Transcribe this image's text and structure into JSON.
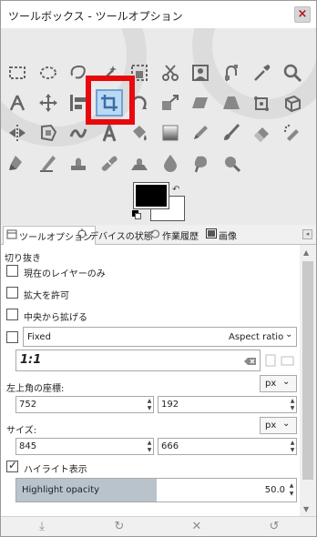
{
  "window": {
    "title": "ツールボックス - ツールオプション",
    "close_glyph": "×"
  },
  "tools": [
    {
      "name": "rect-select-icon"
    },
    {
      "name": "ellipse-select-icon"
    },
    {
      "name": "free-select-icon"
    },
    {
      "name": "fuzzy-select-icon"
    },
    {
      "name": "by-color-select-icon"
    },
    {
      "name": "scissors-select-icon"
    },
    {
      "name": "foreground-select-icon"
    },
    {
      "name": "paths-icon"
    },
    {
      "name": "color-picker-icon"
    },
    {
      "name": "zoom-icon"
    },
    {
      "name": "measure-icon"
    },
    {
      "name": "move-icon"
    },
    {
      "name": "align-icon"
    },
    {
      "name": "crop-icon",
      "active": true
    },
    {
      "name": "rotate-icon"
    },
    {
      "name": "scale-icon"
    },
    {
      "name": "shear-icon"
    },
    {
      "name": "perspective-icon"
    },
    {
      "name": "unified-transform-icon"
    },
    {
      "name": "3d-transform-icon"
    },
    {
      "name": "flip-icon"
    },
    {
      "name": "cage-icon"
    },
    {
      "name": "warp-icon"
    },
    {
      "name": "text-icon"
    },
    {
      "name": "bucket-fill-icon"
    },
    {
      "name": "gradient-icon"
    },
    {
      "name": "pencil-icon"
    },
    {
      "name": "paintbrush-icon"
    },
    {
      "name": "eraser-icon"
    },
    {
      "name": "airbrush-icon"
    },
    {
      "name": "ink-icon"
    },
    {
      "name": "mypaint-brush-icon"
    },
    {
      "name": "clone-icon"
    },
    {
      "name": "heal-icon"
    },
    {
      "name": "perspective-clone-icon"
    },
    {
      "name": "blur-icon"
    },
    {
      "name": "smudge-icon"
    },
    {
      "name": "dodge-burn-icon"
    }
  ],
  "colors": {
    "foreground": "#000000",
    "background": "#ffffff",
    "swap_glyph": "↶"
  },
  "tabs": [
    {
      "label": "ツールオプション",
      "active": true
    },
    {
      "label": "デバイスの状態"
    },
    {
      "label": "作業履歴"
    },
    {
      "label": "画像"
    }
  ],
  "tab_menu_glyph": "◂",
  "options": {
    "title": "切り抜き",
    "current_layer_only": "現在のレイヤーのみ",
    "allow_growing": "拡大を許可",
    "expand_from_center": "中央から拡げる",
    "fixed_label": "Fixed",
    "fixed_mode": "Aspect ratio",
    "fixed_mode_arrow": "⌄",
    "ratio_value": "1:1",
    "position_label": "左上角の座標:",
    "position_x": "752",
    "position_y": "192",
    "unit": "px",
    "unit_arrow": "⌄",
    "size_label": "サイズ:",
    "size_w": "845",
    "size_h": "666",
    "highlight": "ハイライト表示",
    "highlight_opacity_label": "Highlight opacity",
    "highlight_opacity_value": "50.0",
    "highlight_opacity_percent": 50,
    "spin_up": "▲",
    "spin_down": "▼"
  },
  "bottom": {
    "save": "⤓",
    "restore": "↻",
    "delete": "✕",
    "reset": "↺"
  }
}
